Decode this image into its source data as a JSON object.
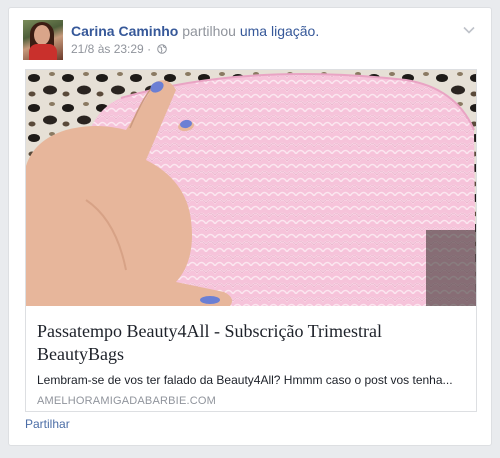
{
  "post": {
    "author": "Carina Caminho",
    "verb": "partilhou",
    "object": "uma ligação.",
    "timestamp": "21/8 às 23:29",
    "separator": "·",
    "privacy_icon": "globe-icon",
    "menu_icon": "chevron-down-icon",
    "avatar": "profile-photo"
  },
  "attachment": {
    "image": "pink-snakeskin-cosmetic-bag-photo",
    "title": "Passatempo Beauty4All - Subscrição Trimestral BeautyBags",
    "description": "Lembram-se de vos ter falado da Beauty4All? Hmmm caso o post vos tenha...",
    "domain": "AMELHORAMIGADABARBIE.COM"
  },
  "actions": {
    "share_label": "Partilhar"
  },
  "colors": {
    "link_blue": "#365899",
    "secondary_text": "#90949c",
    "bag_pink": "#f4b8d2",
    "nail_polish": "#6b7fd4"
  }
}
